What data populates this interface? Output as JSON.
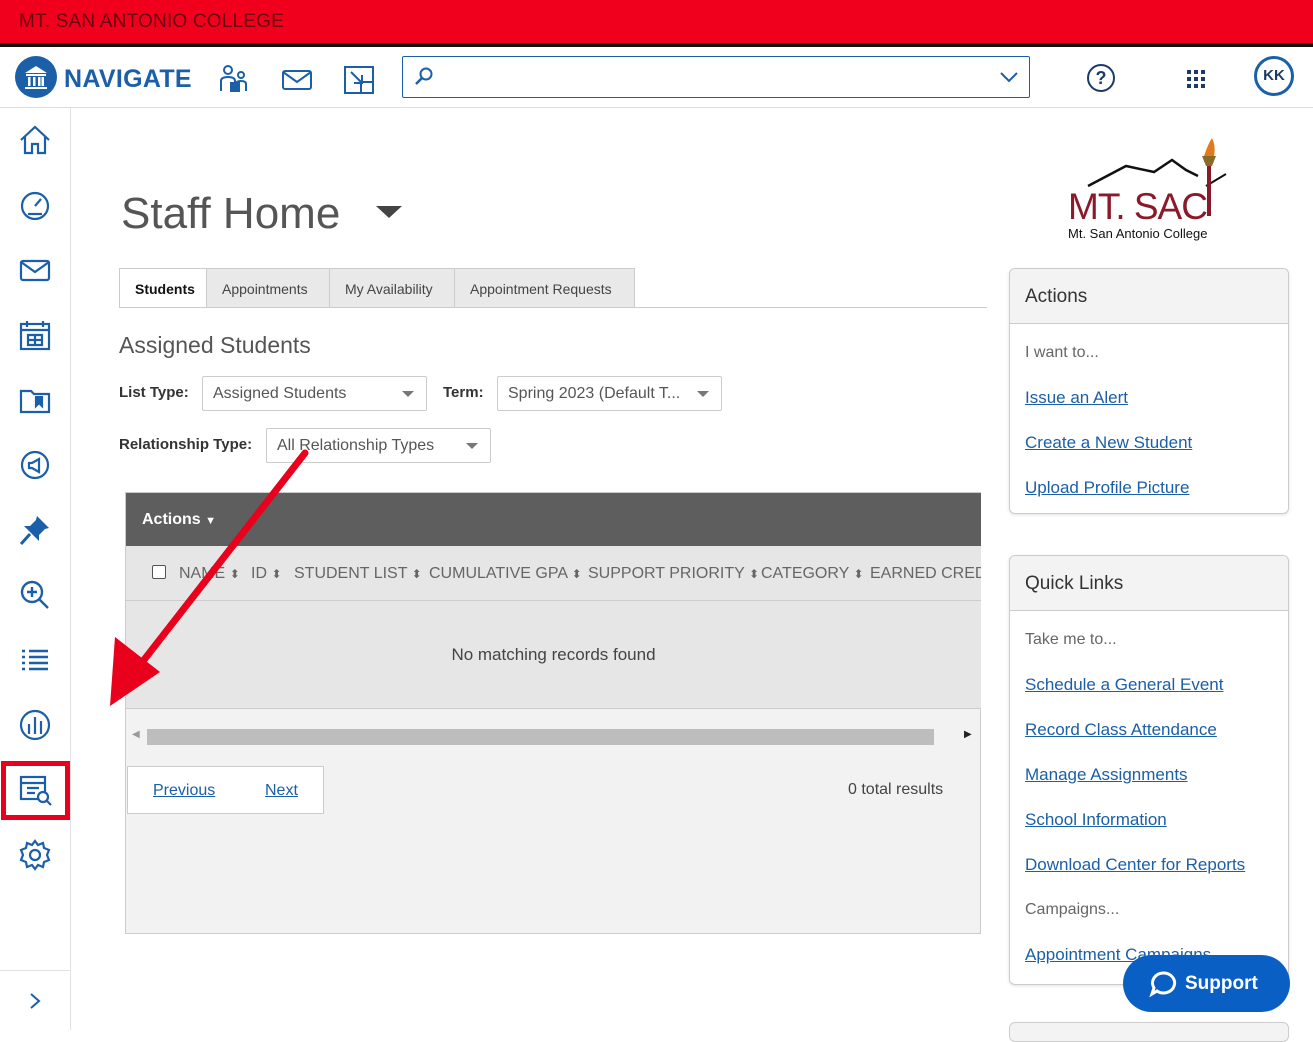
{
  "college_banner": "MT. SAN ANTONIO COLLEGE",
  "header": {
    "app_name": "NAVIGATE",
    "search_placeholder": "",
    "help_label": "?",
    "avatar_initials": "KK"
  },
  "page": {
    "title": "Staff Home",
    "brand_name": "MT. SAC",
    "brand_sub": "Mt. San Antonio College"
  },
  "tabs": [
    {
      "label": "Students"
    },
    {
      "label": "Appointments"
    },
    {
      "label": "My Availability"
    },
    {
      "label": "Appointment Requests"
    }
  ],
  "students": {
    "section_title": "Assigned Students",
    "list_type_label": "List Type:",
    "list_type_value": "Assigned Students",
    "term_label": "Term:",
    "term_value": "Spring 2023 (Default T...",
    "relationship_label": "Relationship Type:",
    "relationship_value": "All Relationship Types"
  },
  "table": {
    "actions_label": "Actions",
    "columns": [
      "NAME",
      "ID",
      "STUDENT LIST",
      "CUMULATIVE GPA",
      "SUPPORT PRIORITY",
      "CATEGORY",
      "EARNED CREDI"
    ],
    "empty_message": "No matching records found",
    "previous_label": "Previous",
    "next_label": "Next",
    "total_results": "0 total results"
  },
  "actions_panel": {
    "title": "Actions",
    "intro": "I want to...",
    "links": [
      "Issue an Alert",
      "Create a New Student",
      "Upload Profile Picture"
    ]
  },
  "quick_links_panel": {
    "title": "Quick Links",
    "intro": "Take me to...",
    "links": [
      "Schedule a General Event",
      "Record Class Attendance",
      "Manage Assignments",
      "School Information",
      "Download Center for Reports"
    ],
    "campaigns_label": "Campaigns...",
    "campaign_links": [
      "Appointment Campaigns"
    ]
  },
  "support_label": "Support",
  "colors": {
    "banner": "#f0001c",
    "brand_blue": "#1a5fa8",
    "annotation_red": "#e8001c"
  }
}
